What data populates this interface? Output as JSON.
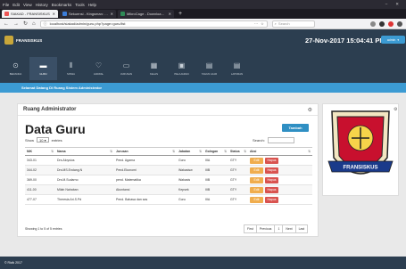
{
  "browser": {
    "menu": [
      "File",
      "Edit",
      "View",
      "History",
      "Bookmarks",
      "Tools",
      "Help"
    ],
    "tabs": [
      {
        "label": "SIAKAD - FRANSISKUS"
      },
      {
        "label": "Sekuensi - Kingsman: The Go"
      },
      {
        "label": "MikroCage - Download Mikrotie"
      }
    ],
    "url": "localhost/siakad/admin/guru.php?page=guru/list",
    "search_placeholder": "Search"
  },
  "header": {
    "brand": "FRANSISKUS",
    "clock": "27-Nov-2017 15:04:41 PM",
    "user": "admin"
  },
  "modules": [
    {
      "label": "BERANDA",
      "icon": "dashboard-icon",
      "glyph": "⊙"
    },
    {
      "label": "GURU",
      "icon": "teacher-icon",
      "glyph": "▬"
    },
    {
      "label": "SISWA",
      "icon": "chart-icon",
      "glyph": "⫴"
    },
    {
      "label": "JADWAL",
      "icon": "heart-icon",
      "glyph": "♡"
    },
    {
      "label": "JURUSAN",
      "icon": "car-icon",
      "glyph": "▭"
    },
    {
      "label": "KELAS",
      "icon": "building-icon",
      "glyph": "▦"
    },
    {
      "label": "PELAJARAN",
      "icon": "image-icon",
      "glyph": "▣"
    },
    {
      "label": "TAHUN AJAR",
      "icon": "calendar-icon",
      "glyph": "▤"
    },
    {
      "label": "LAPORAN",
      "icon": "report-icon",
      "glyph": "▤"
    }
  ],
  "welcome": "Selamat Datang Di Ruang Sistem Administrator",
  "panel": {
    "title": "Ruang Administrator",
    "page_title": "Data Guru",
    "add_button": "Tambah",
    "show_label": "Show",
    "show_value": "10",
    "entries_label": "entries",
    "search_label": "Search:"
  },
  "table": {
    "columns": [
      "NIK",
      "Nama",
      "Jurusan",
      "Jabatan",
      "Golngan",
      "Status",
      "Aksi"
    ],
    "rows": [
      {
        "nik": "343-01",
        "nama": "Drs.Aloysius",
        "jurusan": "Pend. Agama",
        "jabatan": "Guru",
        "golongan": "IIIA",
        "status": "GTY"
      },
      {
        "nik": "344-02",
        "nama": "Drs.MS.Endang.N",
        "jurusan": "Pend.Ekonomi",
        "jabatan": "Wakasisw",
        "golongan": "IIIB",
        "status": "GTY"
      },
      {
        "nik": "369-00",
        "nama": "Drs.M.Sudarno",
        "jurusan": "pend. Matematika",
        "jabatan": "Wakasis",
        "golongan": "IIIB",
        "status": "GTY"
      },
      {
        "nik": "411-00",
        "nama": "Milah Nahaban",
        "jurusan": "Akuntansi",
        "jabatan": "Kepsek",
        "golongan": "IIIB",
        "status": "GTY"
      },
      {
        "nik": "477-07",
        "nama": "Theresia Ari.S.Pd",
        "jurusan": "Pend. Bahasa dan sas",
        "jabatan": "Guru",
        "golongan": "IIIA",
        "status": "GTY"
      }
    ],
    "edit_label": "Edit",
    "delete_label": "Hapus"
  },
  "showing": "Showing 1 to 5 of 5 entries",
  "pager": {
    "first": "First",
    "previous": "Previous",
    "current": "1",
    "next": "Next",
    "last": "Last"
  },
  "emblem": {
    "banner_text": "FRANSISKUS"
  },
  "footer": "© Rizik 2017",
  "colors": {
    "header": "#2c3e50",
    "accent": "#3c9bd3",
    "edit": "#f0ad4e",
    "delete": "#d9534f"
  }
}
